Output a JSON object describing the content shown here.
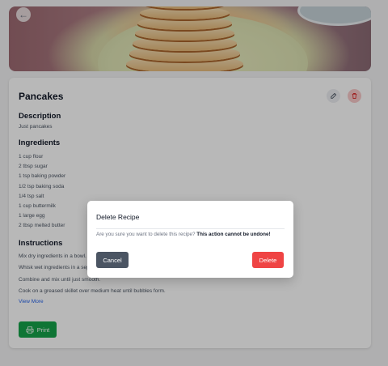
{
  "recipe": {
    "title": "Pancakes",
    "description_heading": "Description",
    "description": "Just pancakes",
    "ingredients_heading": "Ingredients",
    "ingredients": [
      "1 cup flour",
      "2 tbsp sugar",
      "1 tsp baking powder",
      "1/2 tsp baking soda",
      "1/4 tsp salt",
      "1 cup buttermilk",
      "1 large egg",
      "2 tbsp melted butter"
    ],
    "instructions_heading": "Instructions",
    "instructions": [
      "Mix dry ingredients in a bowl.",
      "Whisk wet ingredients in a separate bowl.",
      "Combine and mix until just smooth.",
      "Cook on a greased skillet over medium heat until bubbles form."
    ],
    "view_more": "View More",
    "print_label": "Print"
  },
  "icons": {
    "back": "arrow-left-icon",
    "edit": "pencil-edit-icon",
    "delete": "trash-icon",
    "print": "printer-icon"
  },
  "colors": {
    "print_button": "#16a34a",
    "delete_button": "#ef4444",
    "cancel_button": "#4b5563",
    "link": "#2563eb"
  },
  "dialog": {
    "title": "Delete Recipe",
    "message": "Are you sure you want to delete this recipe?",
    "warning": "This action cannot be undone!",
    "cancel_label": "Cancel",
    "delete_label": "Delete"
  }
}
